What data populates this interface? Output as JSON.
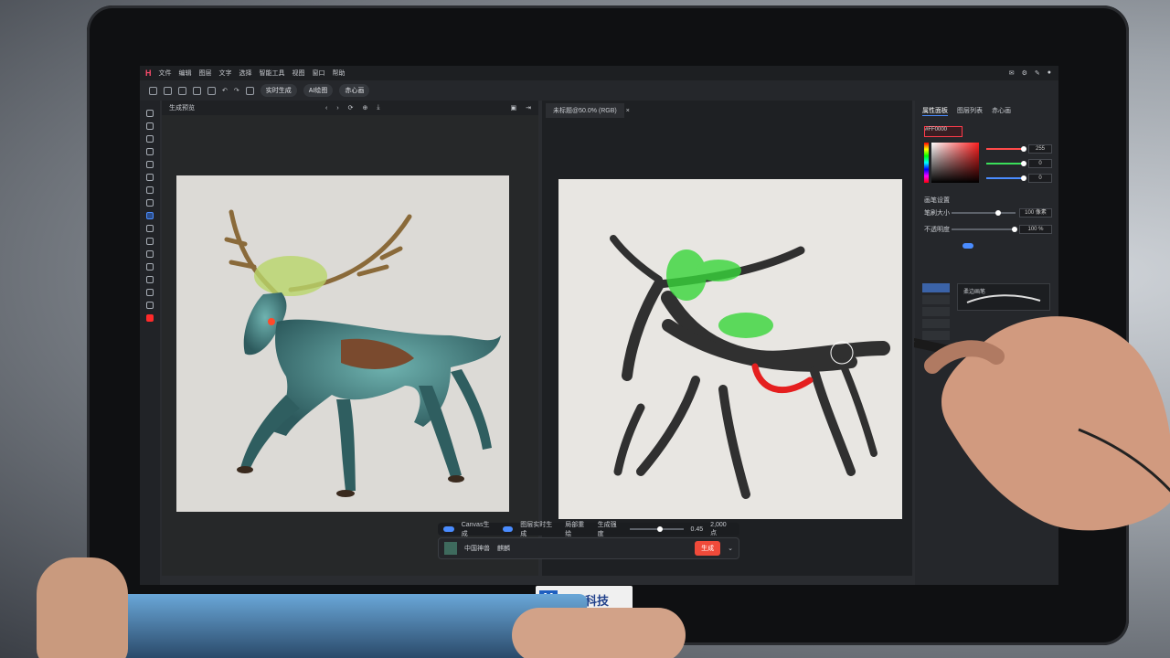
{
  "menubar": {
    "logo": "H",
    "items": [
      "文件",
      "编辑",
      "图层",
      "文字",
      "选择",
      "智能工具",
      "视图",
      "窗口",
      "帮助"
    ]
  },
  "toolbar": {
    "buttons": [
      "new",
      "open",
      "save",
      "print",
      "copy",
      "undo",
      "redo",
      "delete"
    ],
    "pills": [
      "实时生成",
      "AI绘图",
      "赤心画"
    ]
  },
  "left_pane": {
    "header": "生成预览",
    "image_alt": "armored qilin creature"
  },
  "right_pane": {
    "tab": "未标题@50.0% (RGB)",
    "sketch_alt": "rough brush sketch"
  },
  "properties": {
    "tabs": [
      "属性面板",
      "图层列表",
      "赤心画"
    ],
    "hex": "#FF0000",
    "rgb_values": [
      "255",
      "0",
      "0"
    ],
    "brush_section": "画笔设置",
    "brush_size_label": "笔刷大小",
    "brush_size": "100 像素",
    "opacity_label": "不透明度",
    "opacity": "100 %",
    "brush_name": "柔边画笔"
  },
  "bottom_bar": {
    "items": [
      "Canvas生成",
      "图层实时生成",
      "局部重绘",
      "生成强度"
    ],
    "strength_value": "0.45",
    "credit": "2,000 点"
  },
  "prompt_bar": {
    "model": "中国神兽",
    "prompt": "麒麟",
    "generate_label": "生成"
  },
  "brand": {
    "mark": "X",
    "name": "赤心科技"
  }
}
